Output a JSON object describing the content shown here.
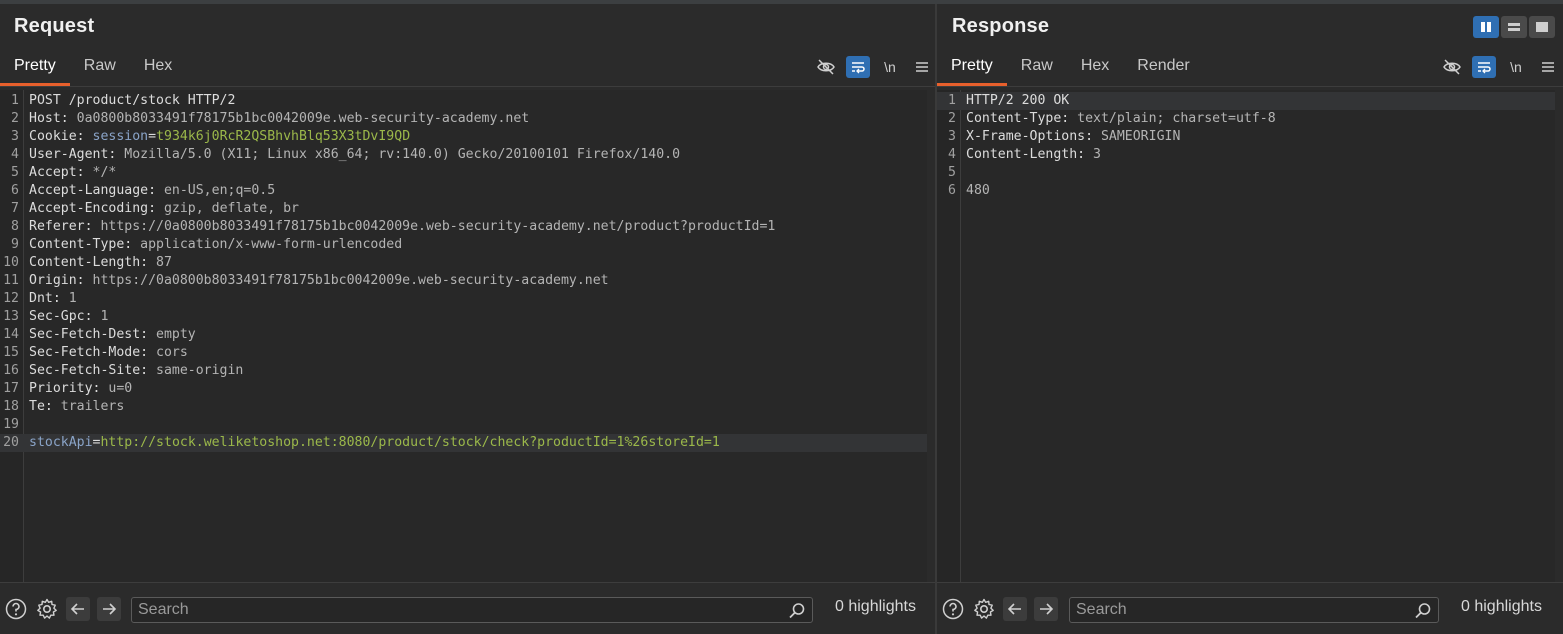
{
  "request": {
    "title": "Request",
    "tabs": [
      "Pretty",
      "Raw",
      "Hex"
    ],
    "active_tab": "Pretty",
    "newline_label": "\\n",
    "lines": [
      {
        "n": "1",
        "key": "POST /product/stock HTTP/2",
        "val": ""
      },
      {
        "n": "2",
        "key": "Host:",
        "val": " 0a0800b8033491f78175b1bc0042009e.web-security-academy.net"
      },
      {
        "n": "3",
        "key": "Cookie:",
        "val": "",
        "cookie_name": "session",
        "cookie_eq": "=",
        "cookie_value": "t934k6j0RcR2QSBhvhBlq53X3tDvI9QD"
      },
      {
        "n": "4",
        "key": "User-Agent:",
        "val": " Mozilla/5.0 (X11; Linux x86_64; rv:140.0) Gecko/20100101 Firefox/140.0"
      },
      {
        "n": "5",
        "key": "Accept:",
        "val": " */*"
      },
      {
        "n": "6",
        "key": "Accept-Language:",
        "val": " en-US,en;q=0.5"
      },
      {
        "n": "7",
        "key": "Accept-Encoding:",
        "val": " gzip, deflate, br"
      },
      {
        "n": "8",
        "key": "Referer:",
        "val": " https://0a0800b8033491f78175b1bc0042009e.web-security-academy.net/product?productId=1"
      },
      {
        "n": "9",
        "key": "Content-Type:",
        "val": " application/x-www-form-urlencoded"
      },
      {
        "n": "10",
        "key": "Content-Length:",
        "val": " 87"
      },
      {
        "n": "11",
        "key": "Origin:",
        "val": " https://0a0800b8033491f78175b1bc0042009e.web-security-academy.net"
      },
      {
        "n": "12",
        "key": "Dnt:",
        "val": " 1"
      },
      {
        "n": "13",
        "key": "Sec-Gpc:",
        "val": " 1"
      },
      {
        "n": "14",
        "key": "Sec-Fetch-Dest:",
        "val": " empty"
      },
      {
        "n": "15",
        "key": "Sec-Fetch-Mode:",
        "val": " cors"
      },
      {
        "n": "16",
        "key": "Sec-Fetch-Site:",
        "val": " same-origin"
      },
      {
        "n": "17",
        "key": "Priority:",
        "val": " u=0"
      },
      {
        "n": "18",
        "key": "Te:",
        "val": " trailers"
      },
      {
        "n": "19",
        "key": "",
        "val": ""
      },
      {
        "n": "20",
        "key": "",
        "val": "",
        "param_name": "stockApi",
        "param_eq": "=",
        "param_value": "http://stock.weliketoshop.net:8080/product/stock/check?productId=1%26storeId=1"
      }
    ],
    "search_placeholder": "Search",
    "highlights": "0 highlights"
  },
  "response": {
    "title": "Response",
    "tabs": [
      "Pretty",
      "Raw",
      "Hex",
      "Render"
    ],
    "active_tab": "Pretty",
    "newline_label": "\\n",
    "lines": [
      {
        "n": "1",
        "key": "HTTP/2 200 OK",
        "val": ""
      },
      {
        "n": "2",
        "key": "Content-Type:",
        "val": " text/plain; charset=utf-8"
      },
      {
        "n": "3",
        "key": "X-Frame-Options:",
        "val": " SAMEORIGIN"
      },
      {
        "n": "4",
        "key": "Content-Length:",
        "val": " 3"
      },
      {
        "n": "5",
        "key": "",
        "val": ""
      },
      {
        "n": "6",
        "key": "480",
        "val": ""
      }
    ],
    "search_placeholder": "Search",
    "highlights": "0 highlights"
  },
  "colors": {
    "accent_tab": "#e8602c",
    "toggle_on": "#2f6fb3",
    "param_value": "#9bb84a",
    "param_name": "#8aa4c8"
  },
  "icons": [
    "eye-slash-icon",
    "wrap-lines-icon",
    "newline-icon",
    "hamburger-menu-icon",
    "help-icon",
    "gear-icon",
    "arrow-left-icon",
    "arrow-right-icon",
    "search-icon",
    "layout-split-icon",
    "layout-stacked-icon",
    "layout-single-icon"
  ]
}
